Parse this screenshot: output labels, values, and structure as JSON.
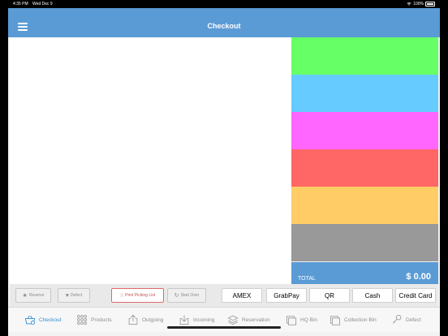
{
  "status_bar": {
    "time": "4:35 PM",
    "date": "Wed Dec 9",
    "battery": "100%"
  },
  "nav": {
    "title": "Checkout",
    "menu_icon": "hamburger-menu-icon"
  },
  "payment_tiles": [
    {
      "color": "#66ff66"
    },
    {
      "color": "#66ccff"
    },
    {
      "color": "#ff66ff"
    },
    {
      "color": "#ff6666"
    },
    {
      "color": "#ffcc66"
    },
    {
      "color": "#999999"
    }
  ],
  "total": {
    "label": "TOTAL",
    "amount": "$ 0.00"
  },
  "actions": {
    "reserve": "Reserve",
    "defect": "Defect",
    "print_picking_list": "Print Picking List",
    "start_over": "Start Over"
  },
  "payment_methods": [
    "AMEX",
    "GrabPay",
    "QR",
    "Cash",
    "Credit Card"
  ],
  "tabs": [
    {
      "label": "Checkout",
      "icon": "basket-icon",
      "active": true
    },
    {
      "label": "Products",
      "icon": "grid-icon",
      "active": false
    },
    {
      "label": "Outgoing",
      "icon": "upload-icon",
      "active": false
    },
    {
      "label": "Incoming",
      "icon": "download-icon",
      "active": false
    },
    {
      "label": "Reservation",
      "icon": "layers-icon",
      "active": false
    },
    {
      "label": "HQ Bin",
      "icon": "bin-icon",
      "active": false
    },
    {
      "label": "Collection Bin",
      "icon": "collection-bin-icon",
      "active": false
    },
    {
      "label": "Defect",
      "icon": "defect-icon",
      "active": false
    }
  ],
  "colors": {
    "accent": "#5b9bd5",
    "active_tab": "#2f8fd8"
  }
}
